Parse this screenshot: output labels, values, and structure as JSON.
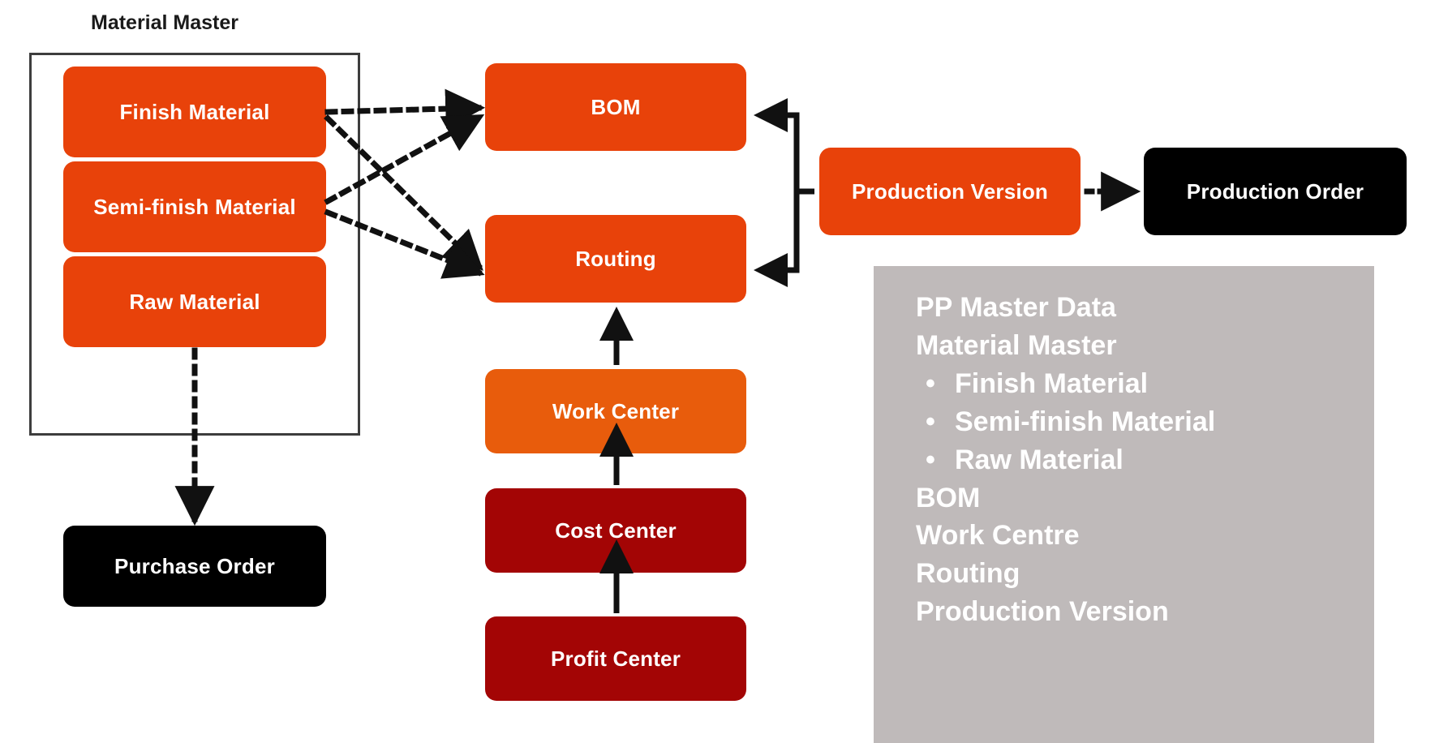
{
  "diagram": {
    "title": "PP Master Data",
    "group": {
      "label": "Material Master"
    },
    "nodes": {
      "finish_material": "Finish Material",
      "semi_finish_material": "Semi-finish Material",
      "raw_material": "Raw Material",
      "purchase_order": "Purchase Order",
      "bom": "BOM",
      "routing": "Routing",
      "work_center": "Work Center",
      "cost_center": "Cost Center",
      "profit_center": "Profit Center",
      "production_version": "Production Version",
      "production_order": "Production Order"
    },
    "colors": {
      "orange": "#e8420a",
      "orange_light": "#e85c0c",
      "dark_red": "#a30505",
      "black": "#000000",
      "panel_gray": "#bfbaba",
      "frame": "#3d3d3d",
      "text_light": "#ffffff",
      "text_dark": "#1a1a1a"
    }
  },
  "legend": {
    "lines": [
      {
        "text": "PP Master Data",
        "bullet": false
      },
      {
        "text": "Material Master",
        "bullet": false
      },
      {
        "text": "Finish Material",
        "bullet": true
      },
      {
        "text": "Semi-finish Material",
        "bullet": true
      },
      {
        "text": "Raw Material",
        "bullet": true
      },
      {
        "text": "BOM",
        "bullet": false
      },
      {
        "text": "Work Centre",
        "bullet": false
      },
      {
        "text": "Routing",
        "bullet": false
      },
      {
        "text": "Production Version",
        "bullet": false
      }
    ]
  }
}
